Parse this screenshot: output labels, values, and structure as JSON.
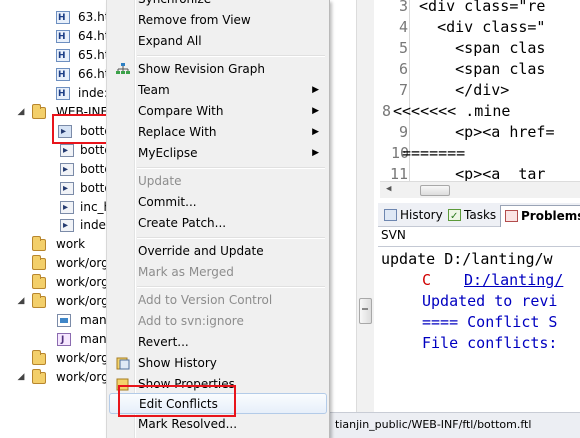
{
  "tree": {
    "items": [
      {
        "label": "63.ht",
        "type": "html"
      },
      {
        "label": "64.ht",
        "type": "html"
      },
      {
        "label": "65.ht",
        "type": "html"
      },
      {
        "label": "66.ht",
        "type": "html"
      },
      {
        "label": "inde:",
        "type": "html"
      },
      {
        "label": "WEB-INF",
        "type": "pkg"
      },
      {
        "label": "botto",
        "type": "ftl"
      },
      {
        "label": "botto",
        "type": "ftl"
      },
      {
        "label": "botto",
        "type": "ftl"
      },
      {
        "label": "botto",
        "type": "ftl"
      },
      {
        "label": "inc_h",
        "type": "ftl"
      },
      {
        "label": "index",
        "type": "ftl"
      },
      {
        "label": "work",
        "type": "pkg"
      },
      {
        "label": "work/org",
        "type": "pkg"
      },
      {
        "label": "work/org",
        "type": "pkg"
      },
      {
        "label": "work/org",
        "type": "pkg"
      },
      {
        "label": "mana",
        "type": "pic"
      },
      {
        "label": "mana",
        "type": "jav"
      },
      {
        "label": "work/org",
        "type": "pkg"
      },
      {
        "label": "work/org",
        "type": "pkg"
      }
    ]
  },
  "menu": {
    "items": [
      {
        "label": "Synchronize",
        "disabled": false,
        "submenu": false
      },
      {
        "label": "Remove from View",
        "disabled": false,
        "submenu": false
      },
      {
        "label": "Expand All",
        "disabled": false,
        "submenu": false
      },
      {
        "label": "Show Revision Graph",
        "disabled": false,
        "submenu": false,
        "icon": "graph-icon"
      },
      {
        "label": "Team",
        "disabled": false,
        "submenu": true
      },
      {
        "label": "Compare With",
        "disabled": false,
        "submenu": true
      },
      {
        "label": "Replace With",
        "disabled": false,
        "submenu": true
      },
      {
        "label": "MyEclipse",
        "disabled": false,
        "submenu": true
      },
      {
        "label": "Update",
        "disabled": true,
        "submenu": false
      },
      {
        "label": "Commit...",
        "disabled": false,
        "submenu": false
      },
      {
        "label": "Create Patch...",
        "disabled": false,
        "submenu": false
      },
      {
        "label": "Override and Update",
        "disabled": false,
        "submenu": false
      },
      {
        "label": "Mark as Merged",
        "disabled": true,
        "submenu": false
      },
      {
        "label": "Add to Version Control",
        "disabled": true,
        "submenu": false
      },
      {
        "label": "Add to svn:ignore",
        "disabled": true,
        "submenu": false
      },
      {
        "label": "Revert...",
        "disabled": false,
        "submenu": false
      },
      {
        "label": "Show History",
        "disabled": false,
        "submenu": false,
        "icon": "history-icon"
      },
      {
        "label": "Show Properties",
        "disabled": false,
        "submenu": false,
        "icon": "properties-icon"
      },
      {
        "label": "Edit Conflicts",
        "disabled": false,
        "submenu": false
      },
      {
        "label": "Mark Resolved...",
        "disabled": false,
        "submenu": false
      }
    ]
  },
  "editor": {
    "lines": [
      {
        "num": "3",
        "code": " <div class=\"re"
      },
      {
        "num": "4",
        "code": "   <div class=\""
      },
      {
        "num": "5",
        "code": "     <span clas"
      },
      {
        "num": "6",
        "code": "     <span clas"
      },
      {
        "num": "7",
        "code": "     </div>"
      },
      {
        "num": "8",
        "code": "<<<<<<< .mine"
      },
      {
        "num": "9",
        "code": "     <p><a href="
      },
      {
        "num": "10",
        "code": "======="
      },
      {
        "num": "11",
        "code": "     <p><a  tar"
      }
    ]
  },
  "tabs": {
    "history": "History",
    "tasks": "Tasks",
    "problems": "Problems"
  },
  "svn": {
    "label": "SVN",
    "lines": [
      {
        "text": "update D:/lanting/w",
        "color": "#000000"
      },
      {
        "prefix": "C",
        "text": "D:/lanting/",
        "color": "#0000c0"
      },
      {
        "text": "Updated to revi",
        "color": "#0000c0"
      },
      {
        "text": "==== Conflict S",
        "color": "#0000c0"
      },
      {
        "text": "File conflicts:",
        "color": "#0000c0"
      }
    ],
    "conflict_color": "#d00000"
  },
  "status": {
    "path": "tianjin_public/WEB-INF/ftl/bottom.ftl"
  },
  "colors": {
    "highlight_box": "#e8141b"
  }
}
